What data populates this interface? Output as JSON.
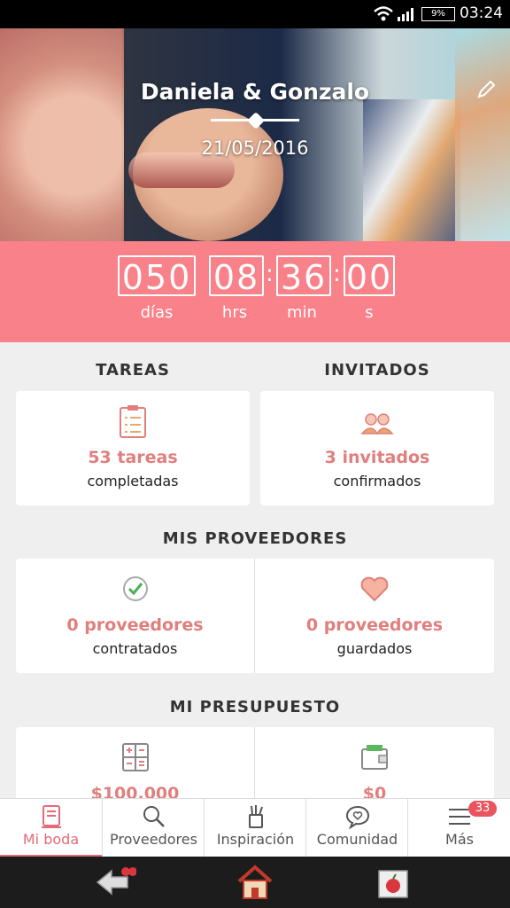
{
  "status_bar": {
    "time": "03:24",
    "battery": "9%"
  },
  "header": {
    "couple": "Daniela & Gonzalo",
    "date": "21/05/2016"
  },
  "countdown": {
    "days": "050",
    "hours": "08",
    "minutes": "36",
    "seconds": "00",
    "days_label": "días",
    "hours_label": "hrs",
    "minutes_label": "min",
    "seconds_label": "s"
  },
  "tasks": {
    "title": "TAREAS",
    "count": "53 tareas",
    "subtitle": "completadas"
  },
  "guests": {
    "title": "INVITADOS",
    "count": "3 invitados",
    "subtitle": "confirmados"
  },
  "vendors": {
    "title": "MIS PROVEEDORES",
    "hired": {
      "count": "0 proveedores",
      "subtitle": "contratados"
    },
    "saved": {
      "count": "0 proveedores",
      "subtitle": "guardados"
    }
  },
  "budget": {
    "title": "MI PRESUPUESTO",
    "estimated": "$100.000",
    "spent": "$0"
  },
  "tabs": [
    {
      "label": "Mi boda",
      "icon": "notebook-icon"
    },
    {
      "label": "Proveedores",
      "icon": "search-icon"
    },
    {
      "label": "Inspiración",
      "icon": "pencil-cup-icon"
    },
    {
      "label": "Comunidad",
      "icon": "chat-heart-icon"
    },
    {
      "label": "Más",
      "icon": "menu-icon",
      "badge": "33"
    }
  ],
  "colors": {
    "accent": "#f8818a",
    "accent_text": "#e07f7d",
    "active_tab": "#e46a76"
  }
}
